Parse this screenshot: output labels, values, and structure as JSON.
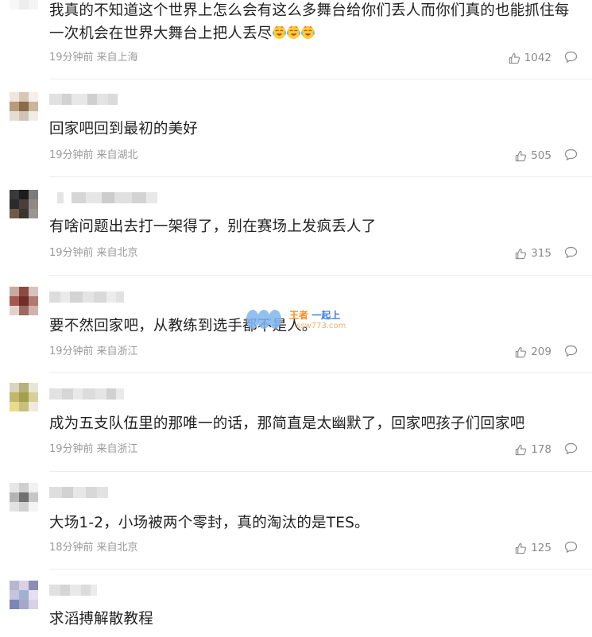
{
  "comments": [
    {
      "text": "我真的不知道这个世界上怎么会有这么多舞台给你们丢人而你们真的也能抓住每一次机会在世界大舞台上把人丢尽",
      "emojis": [
        "crying-laughing-emoji",
        "crying-laughing-emoji",
        "crying-laughing-emoji"
      ],
      "time": "19分钟前",
      "location": "来自上海",
      "likes": "1042",
      "avatar_colors": []
    },
    {
      "text": "回家吧回到最初的美好",
      "time": "19分钟前",
      "location": "来自湖北",
      "likes": "505",
      "avatar_colors": [
        "#efe6dc",
        "#d8c7b3",
        "#f4efe9",
        "#b89a7c",
        "#8b6a4c",
        "#c9b49c",
        "#e6dccf",
        "#cfc3b4",
        "#f0ebe4"
      ]
    },
    {
      "text": "有啥问题出去打一架得了，别在赛场上发疯丢人了",
      "time": "19分钟前",
      "location": "来自北京",
      "likes": "315",
      "avatar_colors": [
        "#3a3a3a",
        "#1c1c1c",
        "#7c7c7c",
        "#2b2b2b",
        "#4a3f3a",
        "#8f8a86",
        "#6e5a4a",
        "#3b3532",
        "#9a9692"
      ]
    },
    {
      "text": "要不然回家吧，从教练到选手都不是人。",
      "time": "19分钟前",
      "location": "来自浙江",
      "likes": "209",
      "avatar_colors": [
        "#c9a9a0",
        "#8e4a42",
        "#d8c2bc",
        "#a4584e",
        "#6e2f2a",
        "#b3786e",
        "#e3d2cc",
        "#9c6a62",
        "#cfb3ab"
      ]
    },
    {
      "text": "成为五支队伍里的那唯一的话，那简直是太幽默了，回家吧孩子们回家吧",
      "time": "19分钟前",
      "location": "来自浙江",
      "likes": "178",
      "avatar_colors": [
        "#d9d4c0",
        "#b8b07a",
        "#e9e6d8",
        "#c2b66a",
        "#a3a04c",
        "#d6cf98",
        "#e8dc8a",
        "#c7bf7c",
        "#eeeadc"
      ]
    },
    {
      "text": "大场1-2，小场被两个零封，真的淘汰的是TES。",
      "time": "18分钟前",
      "location": "来自北京",
      "likes": "125",
      "avatar_colors": [
        "#e6e6e6",
        "#cfcfcf",
        "#f1f1f1",
        "#b4b4b4",
        "#6f6f6f",
        "#c7c7c7",
        "#e2e2e2",
        "#d0d0d0",
        "#f4f4f4"
      ]
    },
    {
      "text": "求滔搏解散教程",
      "time": "",
      "location": "",
      "likes": "",
      "avatar_colors": [
        "#b7b6cf",
        "#d9d2e4",
        "#8e8cb6",
        "#c9c4dc",
        "#9fb2d4",
        "#e5dff0",
        "#7c86b8",
        "#a7a8c8",
        "#d6d2e6"
      ]
    }
  ],
  "watermark": {
    "title_part1": "王者",
    "title_part2": " 一起上",
    "subtitle": "·ssw773.com"
  },
  "colors": {
    "text": "#222222",
    "meta": "#9a9a9a",
    "divider": "#ececec",
    "icon": "#8a8a8a"
  }
}
